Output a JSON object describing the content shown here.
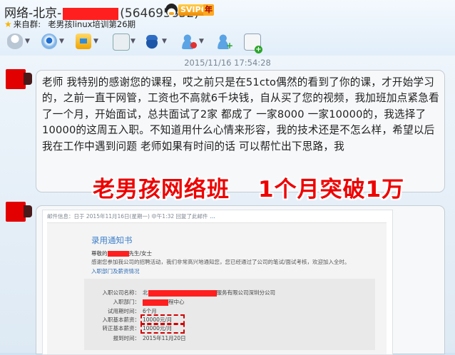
{
  "header": {
    "title_prefix": "网络-北京-",
    "title_suffix": "(564695852)",
    "svip_badge": "SVIP6",
    "year_badge": "年",
    "source_label": "来自群:",
    "source_group": "老男孩linux培训第26期",
    "toolbar": [
      {
        "name": "voice",
        "icon": "microphone-icon"
      },
      {
        "name": "video",
        "icon": "camera-icon"
      },
      {
        "name": "send-file",
        "icon": "share-folder-icon"
      },
      {
        "name": "screen",
        "icon": "screen-icon"
      },
      {
        "name": "app",
        "icon": "grad-cap-icon"
      },
      {
        "name": "remove-friend",
        "icon": "remove-user-icon"
      },
      {
        "name": "add-friend",
        "icon": "add-user-icon"
      },
      {
        "name": "create-discussion",
        "icon": "add-chat-icon"
      }
    ]
  },
  "chat": {
    "timestamp": "2015/11/16 17:54:28",
    "message": "老师 我特别的感谢您的课程，哎之前只是在51cto偶然的看到了你的课，才开始学习的，之前一直干网管，工资也不高就6千块钱，自从买了您的视频，我加班加点紧急看了一个月，开始面试，总共面试了2家 都成了 一家8000 一家10000的，我选择了10000的这周五入职。不知道用什么心情来形容，我的技术还是不怎么样，希望以后我在工作中遇到问题 老师如果有时间的话 可以帮忙出下思路，我",
    "overlay_left": "老男孩网络班",
    "overlay_right": "1个月突破1万"
  },
  "email": {
    "meta": "邮件信息：日于 2015年11月16日(星期一) 中午1:32 回复了此邮件",
    "meta_tail": "...",
    "letter_title": "录用通知书",
    "greeting_prefix": "尊敬的",
    "greeting_suffix": "先生/女士",
    "intro": "感谢您参加我公司的招聘活动，我们非常高兴地通知您，您已经通过了公司的笔试/面试考核，欢迎加入全时。",
    "section": "入职部门及薪资情况",
    "rows": [
      {
        "label": "入职公司名称：",
        "value_prefix": "北",
        "value_suffix": "服务有限公司深圳分公司"
      },
      {
        "label": "入职部门：",
        "value_prefix": "",
        "value_suffix": "程中心"
      },
      {
        "label": "试用期时间：",
        "value_prefix": "6个月",
        "value_suffix": ""
      },
      {
        "label": "入职基本薪资：",
        "value_prefix": "10000元/月",
        "value_suffix": ""
      },
      {
        "label": "转正基本薪资：",
        "value_prefix": "10000元/月",
        "value_suffix": ""
      },
      {
        "label": "报到时间：",
        "value_prefix": "2015年11月20日",
        "value_suffix": ""
      }
    ]
  },
  "colors": {
    "redaction": "#ff1f1f",
    "overlay": "#ee0000",
    "link": "#3b7fcb"
  }
}
